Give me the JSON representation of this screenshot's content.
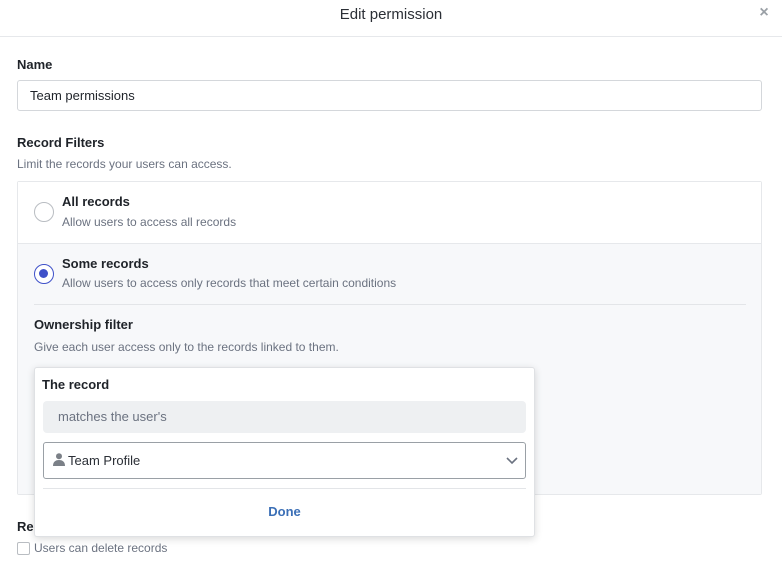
{
  "dialog": {
    "title": "Edit permission",
    "close_icon": "close-icon"
  },
  "name_section": {
    "label": "Name",
    "value": "Team permissions"
  },
  "record_filters": {
    "label": "Record Filters",
    "description": "Limit the records your users can access.",
    "options": [
      {
        "title": "All records",
        "description": "Allow users to access all records",
        "selected": false
      },
      {
        "title": "Some records",
        "description": "Allow users to access only records that meet certain conditions",
        "selected": true
      }
    ],
    "ownership_filter": {
      "label": "Ownership filter",
      "description": "Give each user access only to the records linked to them."
    }
  },
  "popover": {
    "title": "The record",
    "condition": "matches the user's",
    "select_icon": "user-icon",
    "select_value": "Team Profile",
    "done_label": "Done"
  },
  "record_deletion": {
    "label_partial": "Re",
    "checkbox_label": "Users can delete records",
    "checked": false
  },
  "colors": {
    "accent": "#3f51c9",
    "link": "#3b6fb6"
  }
}
